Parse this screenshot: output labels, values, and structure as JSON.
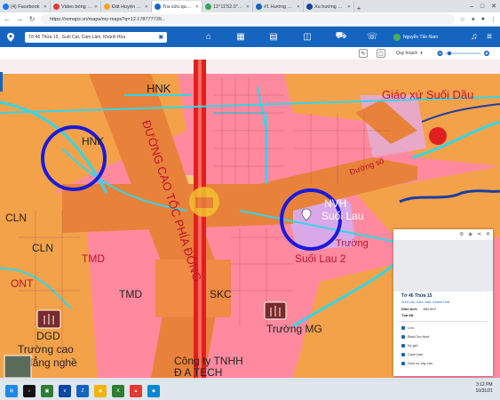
{
  "browser": {
    "tabs": [
      {
        "label": "(4) Facebook",
        "color": "#1877f2",
        "active": false
      },
      {
        "label": "Video bóng đá",
        "color": "#e53935",
        "active": false
      },
      {
        "label": "Đất Huyện Cam",
        "color": "#f6a623",
        "active": false
      },
      {
        "label": "Tra cứu quy hoạ",
        "color": "#1565c0",
        "active": true
      },
      {
        "label": "12°11'52.0\"N 1(",
        "color": "#34a853",
        "active": false
      },
      {
        "label": "#1 Hướng Dẫn",
        "color": "#1565c0",
        "active": false
      },
      {
        "label": "Xu hướng đầu",
        "color": "#0d47a1",
        "active": false
      }
    ],
    "url": "https://remaps.vn/maps/my-maps?q=12.178777739..."
  },
  "app": {
    "search_placeholder": "Tờ 46 Thửa 15 , Suối Cát, Cam Lâm, Khánh Hòa",
    "user_name": "Nguyễn Tấn Nam",
    "quy_hoach_label": "Quy hoạch"
  },
  "map": {
    "labels": {
      "hnk_top": "HNK",
      "hnk_mid": "HNK",
      "cln_1": "CLN",
      "cln_2": "CLN",
      "tmd_1": "TMD",
      "tmd_2": "TMD",
      "ont": "ONT",
      "skc": "SKC",
      "dgd": "DGD",
      "highway": "ĐƯỜNG CAO TỐC PHÍA ĐÔNG",
      "church": "Giáo xứ Suối Dầu",
      "nvh": "NVH",
      "suoi_lau": "Suối Lau",
      "school_right": "Trường MG",
      "school_right_2": "Suối Lau 2",
      "truong": "Trường",
      "school_left": "Trường cao",
      "school_left_2": "đẳng nghề",
      "company": "Công ty TNHH",
      "company_2": "Đ A TECH",
      "road_label": "Đường số",
      "truong_mg": "Trường MG"
    }
  },
  "panel": {
    "title": "Tờ 46 Thửa 15",
    "address": "Suối Cát, Cam Lâm, Khánh Hòa",
    "area_label": "Diện tích:",
    "area_value": "360.9m²",
    "coord_label": "Tọa độ:",
    "actions": [
      "Lưu",
      "Bán/Cho thuê",
      "Ký gửi",
      "Cảnh báo",
      "Dịch vụ xây cao"
    ]
  },
  "taskbar": {
    "time": "3:12 PM",
    "date": "10/31/21"
  },
  "colors": {
    "header_blue": "#1565c0",
    "zone_pink": "#ff8aa0",
    "zone_orange": "#f4a24a",
    "road_orange": "#e8823a",
    "road_cyan": "#33d6e8",
    "highway_red": "#e02020",
    "zone_purple": "#d9a8e8",
    "circle_blue": "#1a1adb",
    "church_red": "#e02020"
  }
}
